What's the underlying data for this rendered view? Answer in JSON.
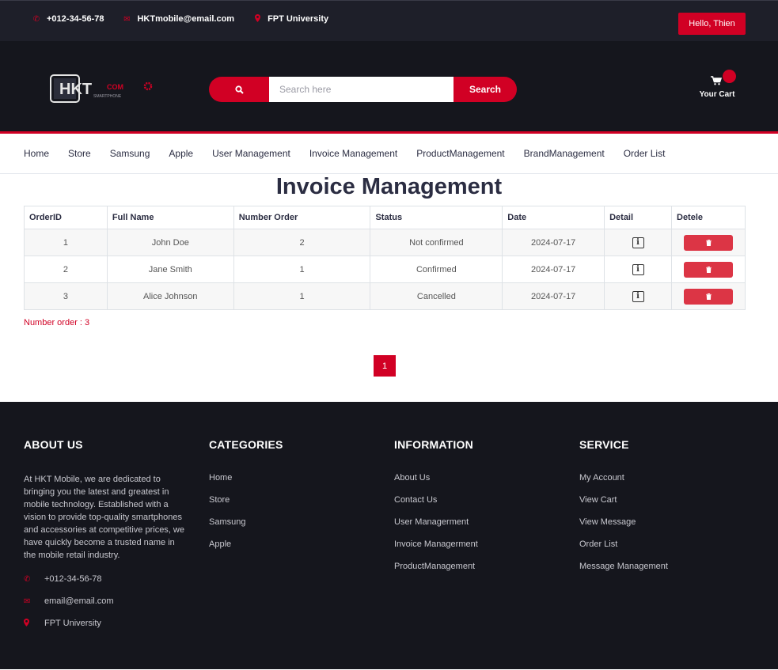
{
  "topbar": {
    "phone": "+012-34-56-78",
    "email": "HKTmobile@email.com",
    "location": "FPT University",
    "user_button": "Hello, Thien"
  },
  "header": {
    "logo_text": "HKT",
    "logo_suffix": "COM",
    "logo_sub": "SMARTPHONE",
    "search_placeholder": "Search here",
    "search_button": "Search",
    "cart_label": "Your Cart"
  },
  "nav": [
    "Home",
    "Store",
    "Samsung",
    "Apple",
    "User Management",
    "Invoice Management",
    "ProductManagement",
    "BrandManagement",
    "Order List"
  ],
  "main": {
    "title": "Invoice Management",
    "columns": [
      "OrderID",
      "Full Name",
      "Number Order",
      "Status",
      "Date",
      "Detail",
      "Detele"
    ],
    "rows": [
      {
        "id": "1",
        "name": "John Doe",
        "number": "2",
        "status": "Not confirmed",
        "date": "2024-07-17"
      },
      {
        "id": "2",
        "name": "Jane Smith",
        "number": "1",
        "status": "Confirmed",
        "date": "2024-07-17"
      },
      {
        "id": "3",
        "name": "Alice Johnson",
        "number": "1",
        "status": "Cancelled",
        "date": "2024-07-17"
      }
    ],
    "count_label": "Number order : 3",
    "current_page": "1"
  },
  "footer": {
    "about": {
      "title": "ABOUT US",
      "text": "At HKT Mobile, we are dedicated to bringing you the latest and greatest in mobile technology. Established with a vision to provide top-quality smartphones and accessories at competitive prices, we have quickly become a trusted name in the mobile retail industry.",
      "phone": "+012-34-56-78",
      "email": "email@email.com",
      "location": "FPT University"
    },
    "categories": {
      "title": "CATEGORIES",
      "items": [
        "Home",
        "Store",
        "Samsung",
        "Apple"
      ]
    },
    "information": {
      "title": "INFORMATION",
      "items": [
        "About Us",
        "Contact Us",
        "User Managerment",
        "Invoice Managerment",
        "ProductManagement"
      ]
    },
    "service": {
      "title": "SERVICE",
      "items": [
        "My Account",
        "View Cart",
        "View Message",
        "Order List",
        "Message Management"
      ]
    }
  },
  "colors": {
    "accent": "#d10024",
    "dark": "#15161d",
    "topbar": "#1e1f29",
    "delete": "#dc3545"
  }
}
